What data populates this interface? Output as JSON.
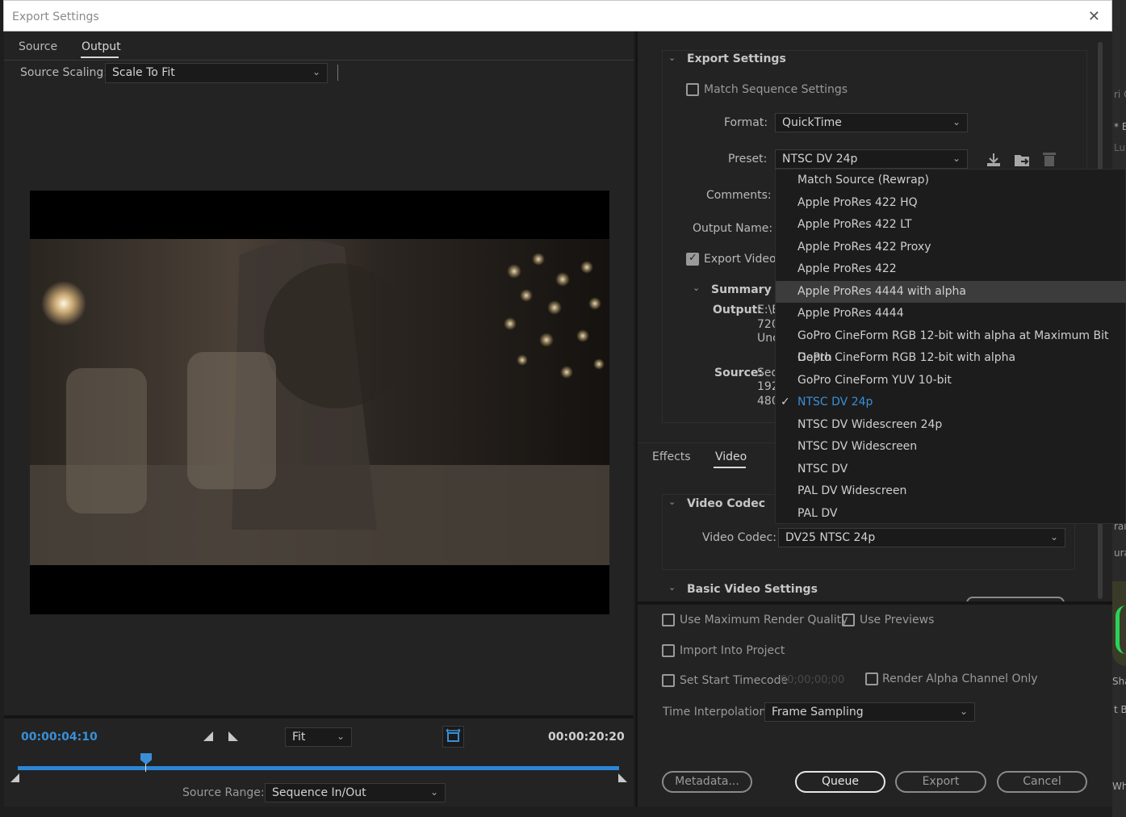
{
  "window": {
    "title": "Export Settings",
    "close_glyph": "✕"
  },
  "left": {
    "tabs": [
      {
        "label": "Source"
      },
      {
        "label": "Output"
      }
    ],
    "source_scaling_label": "Source Scaling:",
    "source_scaling_value": "Scale To Fit",
    "current_time": "00:00:04:10",
    "zoom_value": "Fit",
    "duration": "00:00:20:20",
    "source_range_label": "Source Range:",
    "source_range_value": "Sequence In/Out"
  },
  "right": {
    "export_settings_title": "Export Settings",
    "match_sequence": "Match Sequence Settings",
    "format_label": "Format:",
    "format_value": "QuickTime",
    "preset_label": "Preset:",
    "preset_value": "NTSC DV 24p",
    "comments_label": "Comments:",
    "output_name_label": "Output Name:",
    "export_video": "Export Video",
    "summary_title": "Summary",
    "output_label": "Output:",
    "output_lines": [
      "E:\\E",
      "720",
      "Unc"
    ],
    "source_label": "Source:",
    "source_lines": [
      "Seq",
      "192",
      "480"
    ],
    "tabs": [
      {
        "label": "Effects"
      },
      {
        "label": "Video"
      }
    ],
    "video_codec_section": "Video Codec",
    "video_codec_label": "Video Codec:",
    "video_codec_value": "DV25 NTSC 24p",
    "basic_video_section": "Basic Video Settings",
    "max_render": "Use Maximum Render Quality",
    "use_previews": "Use Previews",
    "import_project": "Import Into Project",
    "set_start_tc": "Set Start Timecode",
    "start_tc_value": "00;00;00;00",
    "render_alpha": "Render Alpha Channel Only",
    "time_interp_label": "Time Interpolation:",
    "time_interp_value": "Frame Sampling",
    "buttons": {
      "metadata": "Metadata...",
      "queue": "Queue",
      "export": "Export",
      "cancel": "Cancel"
    }
  },
  "preset_menu": {
    "items": [
      "Match Source (Rewrap)",
      "Apple ProRes 422 HQ",
      "Apple ProRes 422 LT",
      "Apple ProRes 422 Proxy",
      "Apple ProRes 422",
      "Apple ProRes 4444 with alpha",
      "Apple ProRes 4444",
      "GoPro CineForm RGB 12-bit with alpha at Maximum Bit Depth",
      "GoPro CineForm RGB 12-bit with alpha",
      "GoPro CineForm YUV 10-bit",
      "NTSC DV 24p",
      "NTSC DV Widescreen 24p",
      "NTSC DV Widescreen",
      "NTSC DV",
      "PAL DV Widescreen",
      "PAL DV"
    ],
    "highlighted": "Apple ProRes 4444 with alpha",
    "selected": "NTSC DV 24p"
  },
  "edge_fragments": [
    "ri C",
    "* E",
    "Lu",
    "ral",
    "ura",
    "Sha",
    "t B",
    "Wh"
  ],
  "colors": {
    "accent": "#2c86d6",
    "selected_text": "#3a8fd8",
    "bg": "#232323"
  }
}
